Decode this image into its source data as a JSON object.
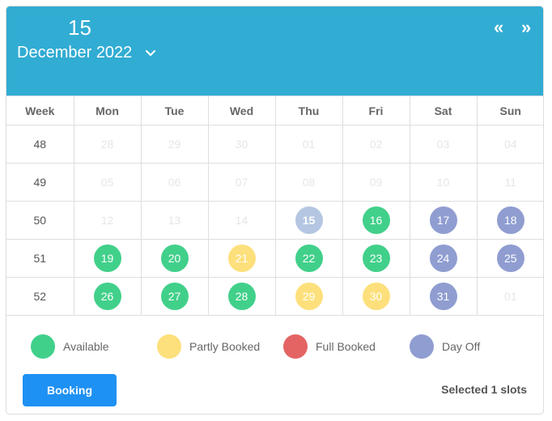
{
  "header": {
    "selected_day": "15",
    "month_year": "December 2022",
    "dropdown_icon": "chevron-down-icon",
    "prev_label": "«",
    "next_label": "»",
    "background_color": "#31acd3"
  },
  "table": {
    "columns": [
      "Week",
      "Mon",
      "Tue",
      "Wed",
      "Thu",
      "Fri",
      "Sat",
      "Sun"
    ],
    "rows": [
      {
        "week": "48",
        "days": [
          {
            "label": "28",
            "status": "outside"
          },
          {
            "label": "29",
            "status": "outside"
          },
          {
            "label": "30",
            "status": "outside"
          },
          {
            "label": "01",
            "status": "past"
          },
          {
            "label": "02",
            "status": "past"
          },
          {
            "label": "03",
            "status": "past"
          },
          {
            "label": "04",
            "status": "past"
          }
        ]
      },
      {
        "week": "49",
        "days": [
          {
            "label": "05",
            "status": "past"
          },
          {
            "label": "06",
            "status": "past"
          },
          {
            "label": "07",
            "status": "past"
          },
          {
            "label": "08",
            "status": "past"
          },
          {
            "label": "09",
            "status": "past"
          },
          {
            "label": "10",
            "status": "past"
          },
          {
            "label": "11",
            "status": "past"
          }
        ]
      },
      {
        "week": "50",
        "days": [
          {
            "label": "12",
            "status": "past"
          },
          {
            "label": "13",
            "status": "past"
          },
          {
            "label": "14",
            "status": "past"
          },
          {
            "label": "15",
            "status": "selected"
          },
          {
            "label": "16",
            "status": "available"
          },
          {
            "label": "17",
            "status": "dayoff"
          },
          {
            "label": "18",
            "status": "dayoff"
          }
        ]
      },
      {
        "week": "51",
        "days": [
          {
            "label": "19",
            "status": "available"
          },
          {
            "label": "20",
            "status": "available"
          },
          {
            "label": "21",
            "status": "partly"
          },
          {
            "label": "22",
            "status": "available"
          },
          {
            "label": "23",
            "status": "available"
          },
          {
            "label": "24",
            "status": "dayoff"
          },
          {
            "label": "25",
            "status": "dayoff"
          }
        ]
      },
      {
        "week": "52",
        "days": [
          {
            "label": "26",
            "status": "available"
          },
          {
            "label": "27",
            "status": "available"
          },
          {
            "label": "28",
            "status": "available"
          },
          {
            "label": "29",
            "status": "partly"
          },
          {
            "label": "30",
            "status": "partly"
          },
          {
            "label": "31",
            "status": "dayoff"
          },
          {
            "label": "01",
            "status": "outside"
          }
        ]
      }
    ]
  },
  "status_colors": {
    "available": "#41d08a",
    "partly": "#fde07c",
    "full": "#e46464",
    "dayoff": "#8f9dd1",
    "selected": "#b4c6e1"
  },
  "legend": [
    {
      "key": "available",
      "label": "Available",
      "color": "#41d08a"
    },
    {
      "key": "partly",
      "label": "Partly Booked",
      "color": "#fde07c"
    },
    {
      "key": "full",
      "label": "Full Booked",
      "color": "#e46464"
    },
    {
      "key": "dayoff",
      "label": "Day Off",
      "color": "#8f9dd1"
    }
  ],
  "footer": {
    "booking_label": "Booking",
    "booking_color": "#1e91f4",
    "selected_text": "Selected 1 slots"
  }
}
